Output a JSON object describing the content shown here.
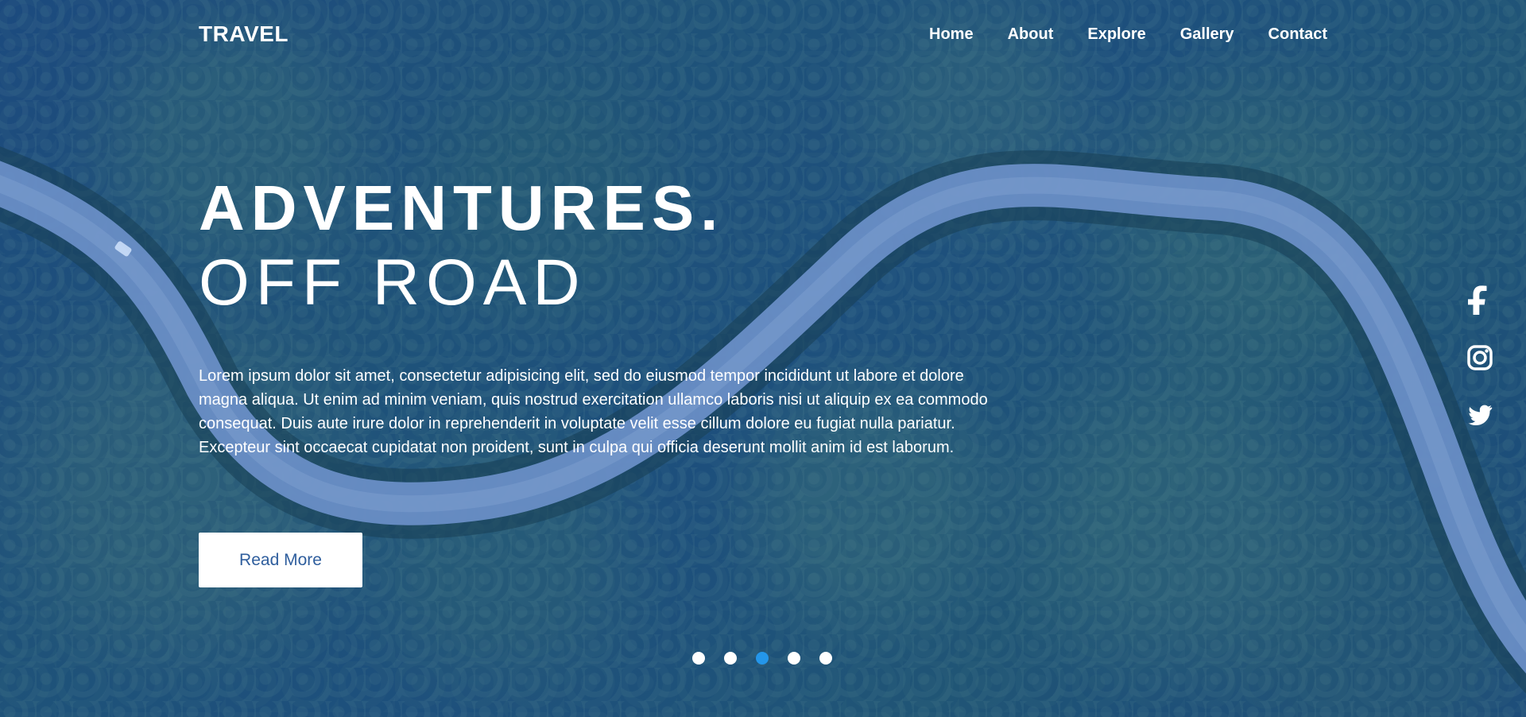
{
  "brand": {
    "name": "TRAVEL"
  },
  "navigation": {
    "items": [
      {
        "label": "Home"
      },
      {
        "label": "About"
      },
      {
        "label": "Explore"
      },
      {
        "label": "Gallery"
      },
      {
        "label": "Contact"
      }
    ]
  },
  "hero": {
    "title_primary": "ADVENTURES.",
    "title_secondary": "OFF ROAD",
    "description": "Lorem ipsum dolor sit amet, consectetur adipisicing elit, sed do eiusmod tempor incididunt ut labore et dolore magna aliqua. Ut enim ad minim veniam, quis nostrud exercitation ullamco laboris nisi ut aliquip ex ea commodo consequat. Duis aute irure dolor in reprehenderit in voluptate velit esse cillum dolore eu fugiat nulla pariatur. Excepteur sint occaecat cupidatat non proident, sunt in culpa qui officia deserunt mollit anim id est laborum.",
    "cta_label": "Read More"
  },
  "social": {
    "icons": [
      "facebook-icon",
      "instagram-icon",
      "twitter-icon"
    ]
  },
  "slider": {
    "current_slide": 3,
    "total_slides": 5
  },
  "colors": {
    "text": "#ffffff",
    "button_text": "#2f5e9d",
    "active_dot": "#2496ea"
  }
}
